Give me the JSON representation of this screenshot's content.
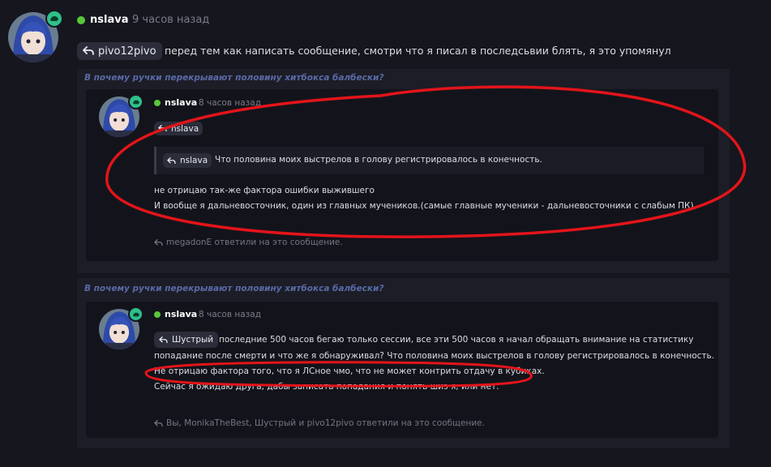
{
  "main_message": {
    "username": "nslava",
    "timestamp": "9 часов назад",
    "reply_to": "pivo12pivo",
    "text": "перед тем как написать сообщение, смотри что я писал в последсьвии блять, я это упомянул"
  },
  "forwarded": [
    {
      "context_title": "В почему ручки перекрывают половину хитбокса балбески?",
      "username": "nslava",
      "timestamp": "8 часов назад",
      "reply_to": "nslava",
      "quote": {
        "reply_to": "nslava",
        "text": "Что половина моих выстрелов в голову регистрировалось в конечность."
      },
      "lines": [
        "не отрицаю так-же фактора ошибки выжившего",
        "И вообще я дальневосточник, один из главных мучеников.(самые главные мученики - дальневосточники с слабым ПК)"
      ],
      "replies": "megadonE ответили на это сообщение."
    },
    {
      "context_title": "В почему ручки перекрывают половину хитбокса балбески?",
      "username": "nslava",
      "timestamp": "8 часов назад",
      "reply_to": "Шустрый",
      "lines": [
        "последние 500 часов бегаю только сессии, все эти 500 часов я начал обращать внимание на статистику",
        "попадание после смерти и что же я обнаруживал? Что половина моих выстрелов в голову регистрировалось в конечность.",
        "Не отрицаю фактора того, что я ЛСное чмо, что не может контрить отдачу в кубиках.",
        "Сейчас я ожидаю друга, дабы записать попадания и понять шиз я, или нет."
      ],
      "replies": "Вы, MonikaTheBest, Шустрый и pivo12pivo ответили на это сообщение."
    }
  ],
  "colors": {
    "background": "#15161e",
    "badge": "#2fc08a",
    "online": "#58c73a",
    "context_link": "#5a6aa6",
    "annotation": "#e3141a"
  }
}
